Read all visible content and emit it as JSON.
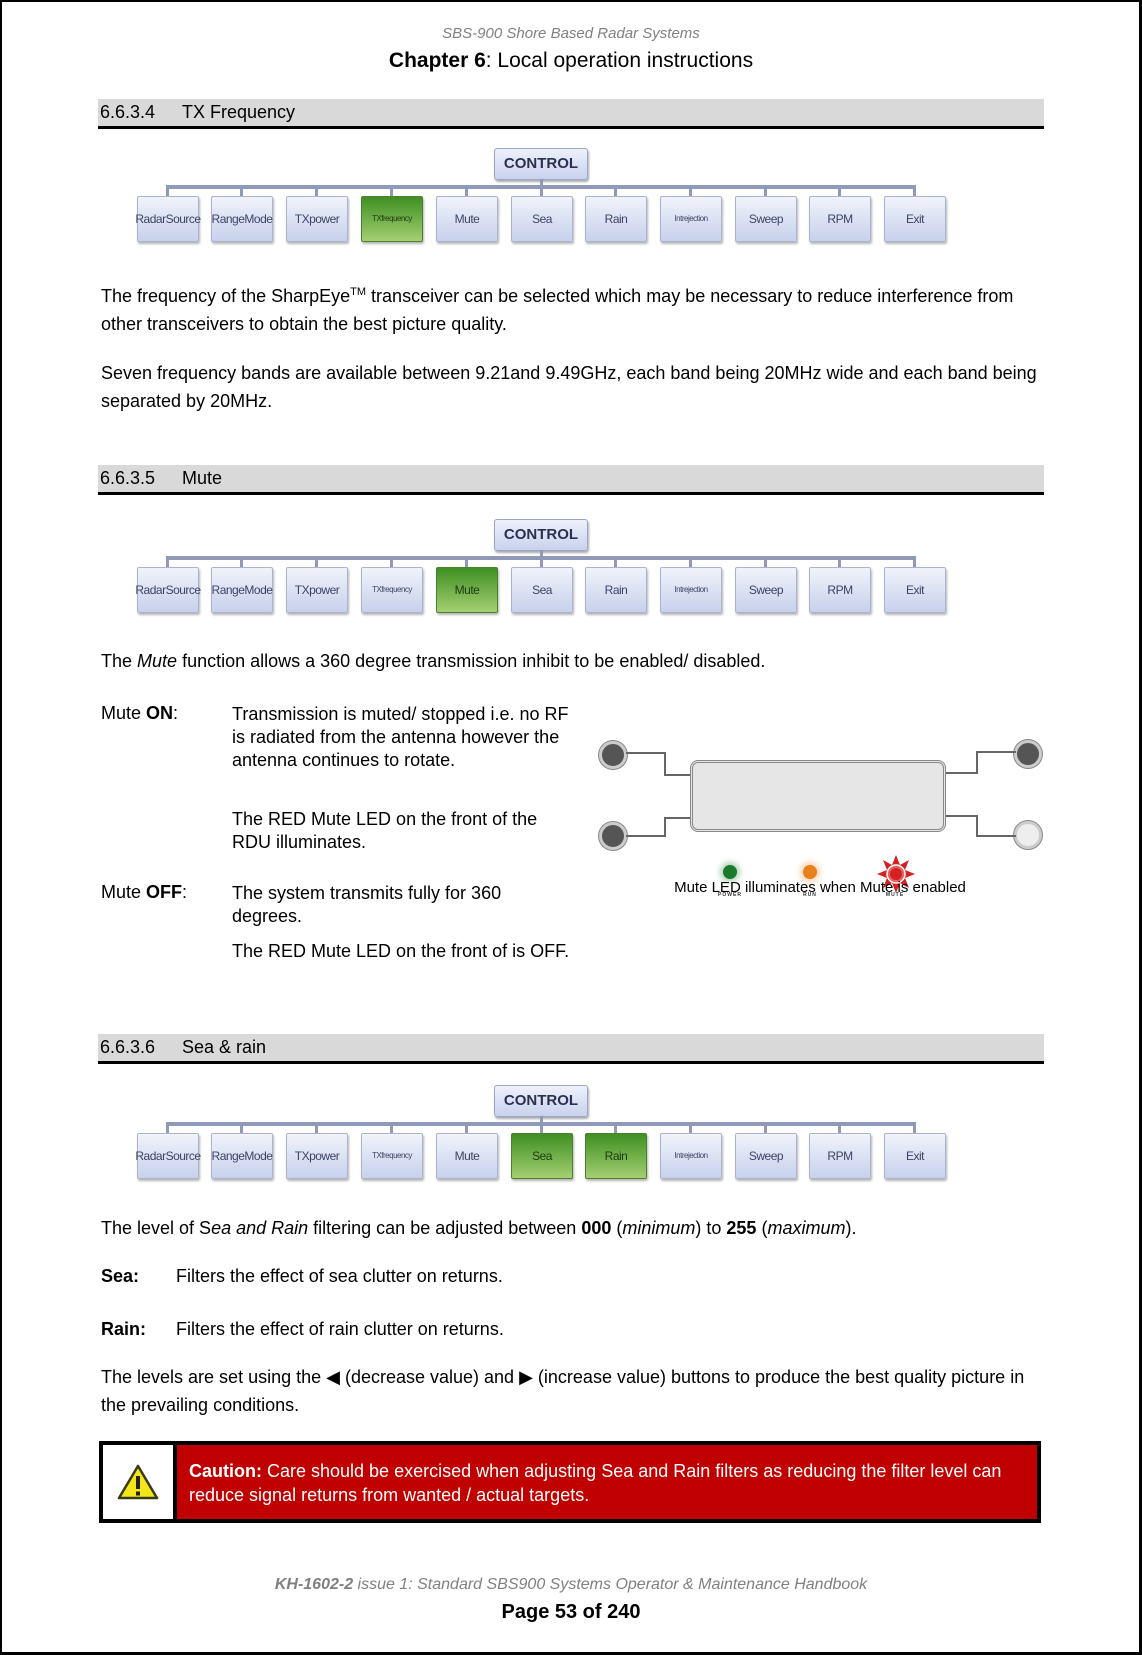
{
  "header": {
    "doc_title": "SBS-900 Shore Based Radar Systems",
    "chapter_label": "Chapter 6",
    "chapter_title": ": Local operation instructions"
  },
  "control_menu": {
    "root_label": "CONTROL",
    "items": [
      "Radar Source",
      "Range Mode",
      "TX power",
      "TX frequency",
      "Mute",
      "Sea",
      "Rain",
      "Int rejection",
      "Sweep",
      "RPM",
      "Exit"
    ]
  },
  "sections": [
    {
      "number": "6.6.3.4",
      "title": "TX Frequency",
      "active_items": [
        "TX frequency"
      ],
      "paragraphs": {
        "p1_a": "The frequency of the SharpEye",
        "p1_sup": "TM",
        "p1_b": " transceiver can be selected which may be necessary to reduce interference from other transceivers to obtain the best picture quality.",
        "p2": "Seven frequency bands are available between 9.21and 9.49GHz, each band being 20MHz wide and each band being separated by 20MHz."
      }
    },
    {
      "number": "6.6.3.5",
      "title": "Mute",
      "active_items": [
        "Mute"
      ],
      "intro_a": "The ",
      "intro_em": "Mute",
      "intro_b": " function allows a 360 degree transmission inhibit to be enabled/ disabled.",
      "mute_on": {
        "label_prefix": "Mute ",
        "label_bold": "ON",
        "label_suffix": ":",
        "text1": "Transmission is muted/ stopped i.e. no RF is radiated from the antenna however the antenna continues to rotate.",
        "text2": "The RED Mute LED on the front of the RDU illuminates."
      },
      "mute_off": {
        "label_prefix": "Mute ",
        "label_bold": "OFF",
        "label_suffix": ":",
        "text1": "The system transmits fully for 360 degrees.",
        "text2": "The RED Mute LED on the front of is OFF."
      },
      "figure": {
        "leds": [
          {
            "label": "POWER",
            "color": "#1a7a2a",
            "state": "on"
          },
          {
            "label": "RUN",
            "color": "#e8801e",
            "state": "on"
          },
          {
            "label": "MUTE",
            "color": "#d42020",
            "state": "illuminated"
          }
        ],
        "caption": "Mute LED illuminates when Mute is enabled"
      }
    },
    {
      "number": "6.6.3.6",
      "title": "Sea & rain",
      "active_items": [
        "Sea",
        "Rain"
      ],
      "intro": {
        "a": "The level of S",
        "em1": "ea and Rain",
        "b": " filtering can be adjusted between ",
        "min_value": "000",
        "c": " (",
        "min_label": "minimum",
        "d": ") to ",
        "max_value": "255",
        "e": " (",
        "max_label": "maximum",
        "f": ")."
      },
      "defs": [
        {
          "term": "Sea:",
          "text": "Filters the effect of sea clutter on returns."
        },
        {
          "term": "Rain:",
          "text": "Filters the effect of rain clutter on returns."
        }
      ],
      "levels_a": "The levels are set using the ",
      "decrease_glyph": "◀",
      "levels_b": " (decrease value) and ",
      "increase_glyph": "▶",
      "levels_c": " (increase value) buttons to produce the best quality picture in the prevailing conditions.",
      "caution": {
        "icon": "warning-triangle-icon",
        "label": "Caution:",
        "text": " Care should be exercised when adjusting Sea and Rain filters as reducing the filter level can reduce signal returns from wanted / actual targets.",
        "bg_color": "#c00000"
      }
    }
  ],
  "footer": {
    "doc_code": "KH-1602-2",
    "doc_desc": " issue 1: Standard SBS900 Systems Operator & Maintenance Handbook",
    "page_label": "Page 53 of 240"
  }
}
